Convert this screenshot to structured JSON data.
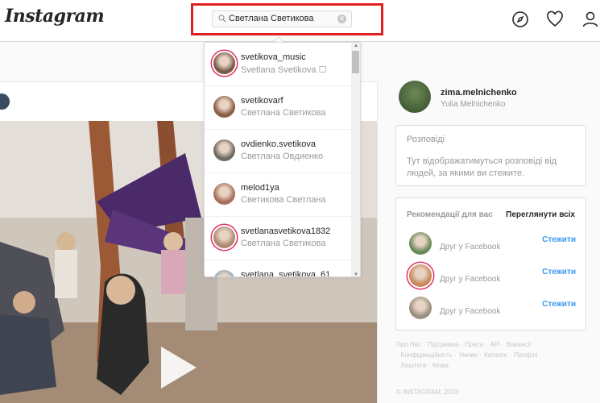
{
  "header": {
    "logo": "Instagram",
    "search_value": "Светлана Светикова",
    "clear_glyph": "✕"
  },
  "search_results": [
    {
      "username": "svetikova_music",
      "name": "Svetlana Svetikova ☐",
      "story": true,
      "color": "#7b5a4a"
    },
    {
      "username": "svetikovarf",
      "name": "Светлана Светикова",
      "story": false,
      "color": "#8a5e45"
    },
    {
      "username": "ovdienko.svetikova",
      "name": "Светлана Овдиенко",
      "story": false,
      "color": "#6e6a62"
    },
    {
      "username": "melod1ya",
      "name": "Светикова Светлана",
      "story": false,
      "color": "#a86f5a"
    },
    {
      "username": "svetlanasvetikova1832",
      "name": "Светлана Светикова",
      "story": true,
      "color": "#b08a70"
    },
    {
      "username": "svetlana_svetikova_61",
      "name": "",
      "story": false,
      "color": "#8aa6b8"
    }
  ],
  "scrollbar": {
    "up": "▲",
    "down": "▼"
  },
  "profile": {
    "username": "zima.melnichenko",
    "name": "Yulia Melnichenko"
  },
  "stories": {
    "title": "Розповіді",
    "empty_text": "Тут відображатимуться розповіді від людей, за якими ви стежите."
  },
  "recommendations": {
    "title": "Рекомендації для вас",
    "see_all": "Переглянути всіх",
    "items": [
      {
        "subtitle": "Друг у Facebook",
        "follow": "Стежити",
        "story": false,
        "color": "#6a8a5a"
      },
      {
        "subtitle": "Друг у Facebook",
        "follow": "Стежити",
        "story": true,
        "color": "#c98a5a"
      },
      {
        "subtitle": "Друг у Facebook",
        "follow": "Стежити",
        "story": false,
        "color": "#9a8f80"
      }
    ]
  },
  "footer": {
    "links": [
      "Про Нас ·",
      "Підтримка ·",
      "Преса ·",
      "API ·",
      "Вакансії ·",
      "Конфіденційність ·",
      "Умови ·",
      "Каталог ·",
      "Профілі ·",
      "Хештеги ·",
      "Мова"
    ],
    "copyright": "© INSTAGRAM, 2018"
  }
}
